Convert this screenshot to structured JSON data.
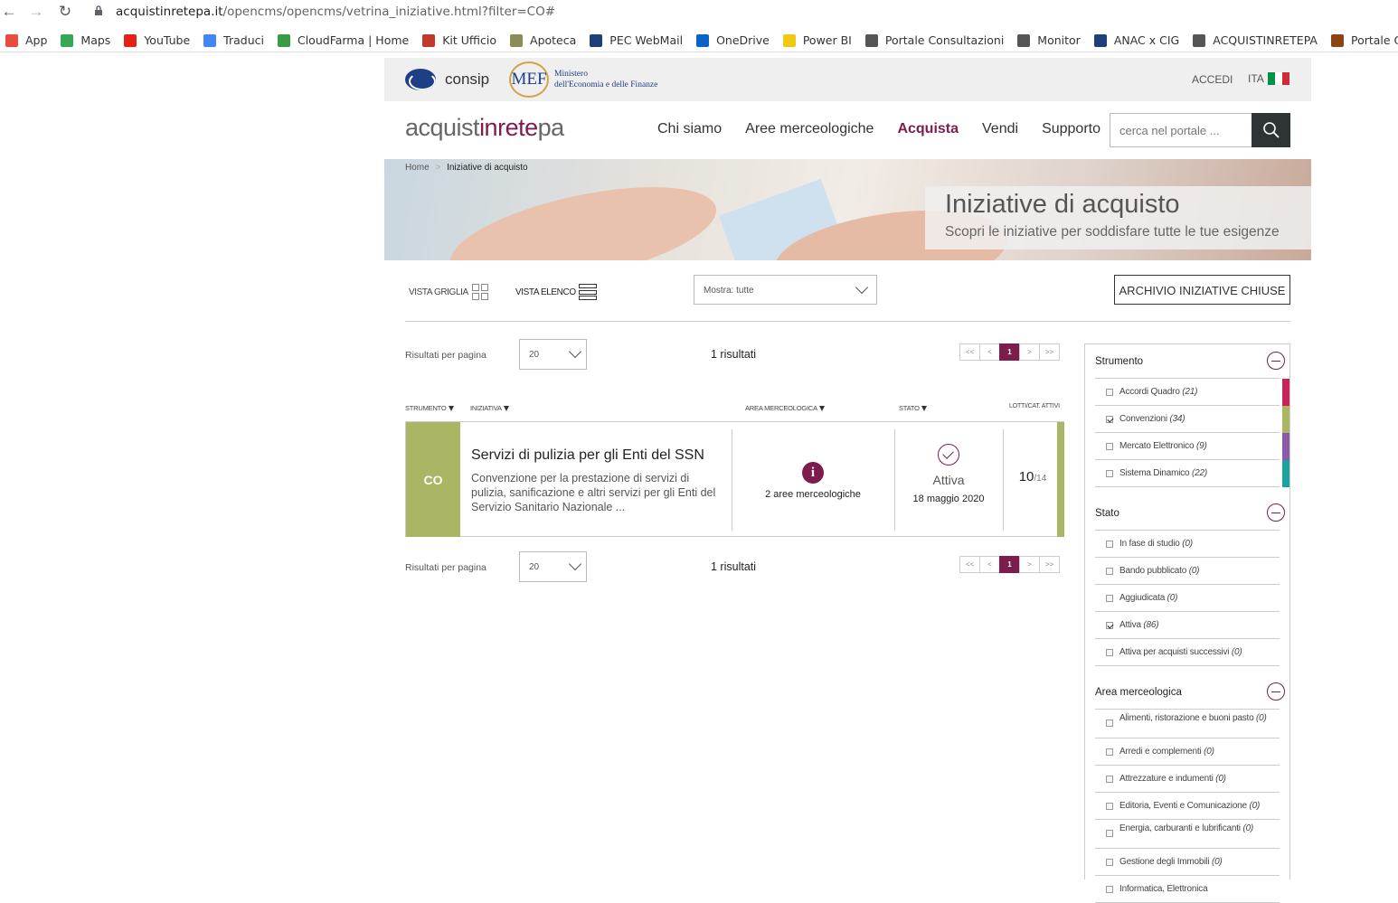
{
  "browser": {
    "url_domain": "acquistinretepa.it",
    "url_path": "/opencms/opencms/vetrina_iniziative.html?filter=CO#",
    "bookmarks": [
      {
        "label": "App",
        "color": "#e84c3d"
      },
      {
        "label": "Maps",
        "color": "#34a853"
      },
      {
        "label": "YouTube",
        "color": "#e62117"
      },
      {
        "label": "Traduci",
        "color": "#4285f4"
      },
      {
        "label": "CloudFarma | Home",
        "color": "#3a9b45"
      },
      {
        "label": "Kit Ufficio",
        "color": "#c0392b"
      },
      {
        "label": "Apoteca",
        "color": "#8c8c5a"
      },
      {
        "label": "PEC WebMail",
        "color": "#1f3f7a"
      },
      {
        "label": "OneDrive",
        "color": "#0a64c8"
      },
      {
        "label": "Power BI",
        "color": "#f2c811"
      },
      {
        "label": "Portale Consultazioni",
        "color": "#555555"
      },
      {
        "label": "Monitor",
        "color": "#555555"
      },
      {
        "label": "ANAC x CIG",
        "color": "#1f3f7a"
      },
      {
        "label": "ACQUISTINRETEPA",
        "color": "#555555"
      },
      {
        "label": "Portale Operatori T...",
        "color": "#8b4513"
      }
    ]
  },
  "topbar": {
    "consip": "consip",
    "mef_mark": "MEF",
    "mef_line1": "Ministero",
    "mef_line2": "dell'Economia e delle Finanze",
    "accedi": "ACCEDI",
    "lang": "ITA",
    "flag_colors": [
      "#009246",
      "#ffffff",
      "#ce2b37"
    ]
  },
  "header": {
    "brand_a": "acquist",
    "brand_b": "inrete",
    "brand_c": "pa",
    "nav": [
      "Chi siamo",
      "Aree merceologiche",
      "Acquista",
      "Vendi",
      "Supporto"
    ],
    "search_placeholder": "cerca nel portale ..."
  },
  "hero": {
    "breadcrumb_home": "Home",
    "breadcrumb_sep": ">",
    "breadcrumb_current": "Iniziative di acquisto",
    "title": "Iniziative di acquisto",
    "subtitle": "Scopri le iniziative per soddisfare tutte le tue esigenze"
  },
  "toolbar": {
    "vista_griglia": "VISTA GRIGLIA",
    "vista_elenco": "VISTA ELENCO",
    "mostra": "Mostra: tutte",
    "archivio": "ARCHIVIO INIZIATIVE CHIUSE"
  },
  "results": {
    "per_page_label": "Risultati per pagina",
    "per_page": "20",
    "count": "1 risultati",
    "pager": [
      "<<",
      "<",
      "1",
      ">",
      ">>"
    ]
  },
  "columns": {
    "strumento": "STRUMENTO",
    "iniziativa": "INIZIATIVA",
    "area": "AREA MERCEOLOGICA",
    "stato": "STATO",
    "lotti": "LOTTI/CAT. ATTIVI"
  },
  "card": {
    "tag": "CO",
    "accent": "#aab664",
    "title": "Servizi di pulizia per gli Enti del SSN",
    "desc": "Convenzione per la prestazione di servizi di pulizia, sanificazione e altri servizi per gli Enti del Servizio Sanitario Nazionale ...",
    "area_icon": "i",
    "area_label": "2 aree merceologiche",
    "stato": "Attiva",
    "date": "18 maggio 2020",
    "lotti_active": "10",
    "lotti_total": "/14"
  },
  "filters": {
    "strumento": {
      "title": "Strumento",
      "items": [
        {
          "label": "Accordi Quadro",
          "count": "(21)",
          "checked": false,
          "color": "#c7245e"
        },
        {
          "label": "Convenzioni",
          "count": "(34)",
          "checked": true,
          "color": "#aab664"
        },
        {
          "label": "Mercato Elettronico",
          "count": "(9)",
          "checked": false,
          "color": "#8e5aa8"
        },
        {
          "label": "Sistema Dinamico",
          "count": "(22)",
          "checked": false,
          "color": "#1aa3a0"
        }
      ]
    },
    "stato": {
      "title": "Stato",
      "items": [
        {
          "label": "In fase di studio",
          "count": "(0)",
          "checked": false
        },
        {
          "label": "Bando pubblicato",
          "count": "(0)",
          "checked": false
        },
        {
          "label": "Aggiudicata",
          "count": "(0)",
          "checked": false
        },
        {
          "label": "Attiva",
          "count": "(86)",
          "checked": true
        },
        {
          "label": "Attiva per acquisti successivi",
          "count": "(0)",
          "checked": false
        }
      ]
    },
    "area": {
      "title": "Area merceologica",
      "items": [
        {
          "label": "Alimenti, ristorazione e buoni pasto",
          "count": "(0)",
          "checked": false
        },
        {
          "label": "Arredi e complementi",
          "count": "(0)",
          "checked": false
        },
        {
          "label": "Attrezzature e indumenti",
          "count": "(0)",
          "checked": false
        },
        {
          "label": "Editoria, Eventi e Comunicazione",
          "count": "(0)",
          "checked": false
        },
        {
          "label": "Energia, carburanti e lubrificanti",
          "count": "(0)",
          "checked": false
        },
        {
          "label": "Gestione degli Immobili",
          "count": "(0)",
          "checked": false
        },
        {
          "label": "Informatica, Elettronica",
          "count": "",
          "checked": false
        }
      ]
    }
  }
}
